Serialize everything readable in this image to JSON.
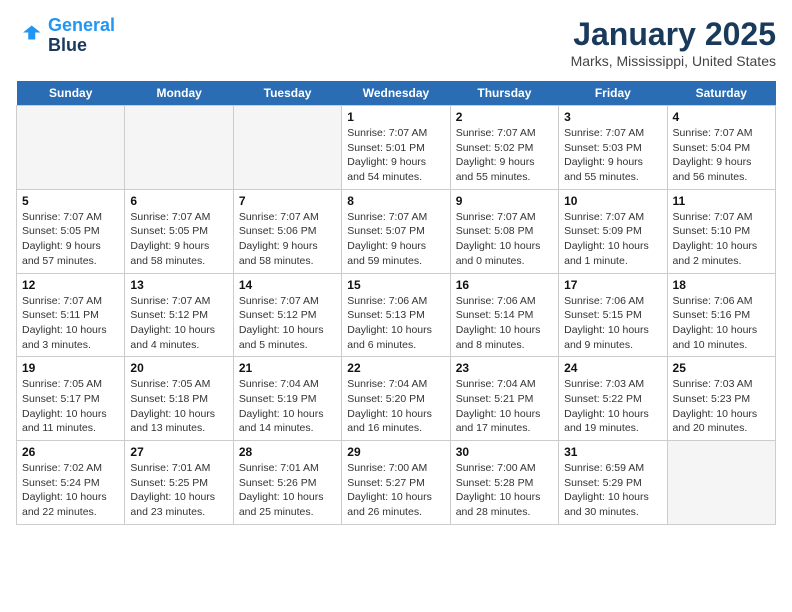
{
  "header": {
    "logo_line1": "General",
    "logo_line2": "Blue",
    "month": "January 2025",
    "location": "Marks, Mississippi, United States"
  },
  "weekdays": [
    "Sunday",
    "Monday",
    "Tuesday",
    "Wednesday",
    "Thursday",
    "Friday",
    "Saturday"
  ],
  "weeks": [
    [
      {
        "day": "",
        "info": ""
      },
      {
        "day": "",
        "info": ""
      },
      {
        "day": "",
        "info": ""
      },
      {
        "day": "1",
        "info": "Sunrise: 7:07 AM\nSunset: 5:01 PM\nDaylight: 9 hours\nand 54 minutes."
      },
      {
        "day": "2",
        "info": "Sunrise: 7:07 AM\nSunset: 5:02 PM\nDaylight: 9 hours\nand 55 minutes."
      },
      {
        "day": "3",
        "info": "Sunrise: 7:07 AM\nSunset: 5:03 PM\nDaylight: 9 hours\nand 55 minutes."
      },
      {
        "day": "4",
        "info": "Sunrise: 7:07 AM\nSunset: 5:04 PM\nDaylight: 9 hours\nand 56 minutes."
      }
    ],
    [
      {
        "day": "5",
        "info": "Sunrise: 7:07 AM\nSunset: 5:05 PM\nDaylight: 9 hours\nand 57 minutes."
      },
      {
        "day": "6",
        "info": "Sunrise: 7:07 AM\nSunset: 5:05 PM\nDaylight: 9 hours\nand 58 minutes."
      },
      {
        "day": "7",
        "info": "Sunrise: 7:07 AM\nSunset: 5:06 PM\nDaylight: 9 hours\nand 58 minutes."
      },
      {
        "day": "8",
        "info": "Sunrise: 7:07 AM\nSunset: 5:07 PM\nDaylight: 9 hours\nand 59 minutes."
      },
      {
        "day": "9",
        "info": "Sunrise: 7:07 AM\nSunset: 5:08 PM\nDaylight: 10 hours\nand 0 minutes."
      },
      {
        "day": "10",
        "info": "Sunrise: 7:07 AM\nSunset: 5:09 PM\nDaylight: 10 hours\nand 1 minute."
      },
      {
        "day": "11",
        "info": "Sunrise: 7:07 AM\nSunset: 5:10 PM\nDaylight: 10 hours\nand 2 minutes."
      }
    ],
    [
      {
        "day": "12",
        "info": "Sunrise: 7:07 AM\nSunset: 5:11 PM\nDaylight: 10 hours\nand 3 minutes."
      },
      {
        "day": "13",
        "info": "Sunrise: 7:07 AM\nSunset: 5:12 PM\nDaylight: 10 hours\nand 4 minutes."
      },
      {
        "day": "14",
        "info": "Sunrise: 7:07 AM\nSunset: 5:12 PM\nDaylight: 10 hours\nand 5 minutes."
      },
      {
        "day": "15",
        "info": "Sunrise: 7:06 AM\nSunset: 5:13 PM\nDaylight: 10 hours\nand 6 minutes."
      },
      {
        "day": "16",
        "info": "Sunrise: 7:06 AM\nSunset: 5:14 PM\nDaylight: 10 hours\nand 8 minutes."
      },
      {
        "day": "17",
        "info": "Sunrise: 7:06 AM\nSunset: 5:15 PM\nDaylight: 10 hours\nand 9 minutes."
      },
      {
        "day": "18",
        "info": "Sunrise: 7:06 AM\nSunset: 5:16 PM\nDaylight: 10 hours\nand 10 minutes."
      }
    ],
    [
      {
        "day": "19",
        "info": "Sunrise: 7:05 AM\nSunset: 5:17 PM\nDaylight: 10 hours\nand 11 minutes."
      },
      {
        "day": "20",
        "info": "Sunrise: 7:05 AM\nSunset: 5:18 PM\nDaylight: 10 hours\nand 13 minutes."
      },
      {
        "day": "21",
        "info": "Sunrise: 7:04 AM\nSunset: 5:19 PM\nDaylight: 10 hours\nand 14 minutes."
      },
      {
        "day": "22",
        "info": "Sunrise: 7:04 AM\nSunset: 5:20 PM\nDaylight: 10 hours\nand 16 minutes."
      },
      {
        "day": "23",
        "info": "Sunrise: 7:04 AM\nSunset: 5:21 PM\nDaylight: 10 hours\nand 17 minutes."
      },
      {
        "day": "24",
        "info": "Sunrise: 7:03 AM\nSunset: 5:22 PM\nDaylight: 10 hours\nand 19 minutes."
      },
      {
        "day": "25",
        "info": "Sunrise: 7:03 AM\nSunset: 5:23 PM\nDaylight: 10 hours\nand 20 minutes."
      }
    ],
    [
      {
        "day": "26",
        "info": "Sunrise: 7:02 AM\nSunset: 5:24 PM\nDaylight: 10 hours\nand 22 minutes."
      },
      {
        "day": "27",
        "info": "Sunrise: 7:01 AM\nSunset: 5:25 PM\nDaylight: 10 hours\nand 23 minutes."
      },
      {
        "day": "28",
        "info": "Sunrise: 7:01 AM\nSunset: 5:26 PM\nDaylight: 10 hours\nand 25 minutes."
      },
      {
        "day": "29",
        "info": "Sunrise: 7:00 AM\nSunset: 5:27 PM\nDaylight: 10 hours\nand 26 minutes."
      },
      {
        "day": "30",
        "info": "Sunrise: 7:00 AM\nSunset: 5:28 PM\nDaylight: 10 hours\nand 28 minutes."
      },
      {
        "day": "31",
        "info": "Sunrise: 6:59 AM\nSunset: 5:29 PM\nDaylight: 10 hours\nand 30 minutes."
      },
      {
        "day": "",
        "info": ""
      }
    ]
  ]
}
